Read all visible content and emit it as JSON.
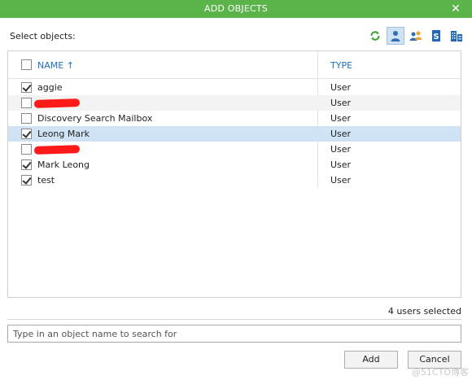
{
  "dialog": {
    "title": "ADD OBJECTS",
    "close_glyph": "✕"
  },
  "select_label": "Select objects:",
  "toolbar": {
    "icons": [
      "refresh-icon",
      "user-icon",
      "group-icon",
      "sharepoint-icon",
      "building-icon"
    ],
    "active": "user-icon"
  },
  "table": {
    "header": {
      "name": "NAME",
      "sort_arrow": "↑",
      "type": "TYPE"
    },
    "rows": [
      {
        "name": "aggie",
        "type": "User",
        "checked": true
      },
      {
        "name": "",
        "type": "User",
        "checked": false,
        "redacted": true
      },
      {
        "name": "Discovery Search Mailbox",
        "type": "User",
        "checked": false
      },
      {
        "name": "Leong Mark",
        "type": "User",
        "checked": true,
        "selected": true
      },
      {
        "name": "",
        "type": "User",
        "checked": false,
        "redacted": true
      },
      {
        "name": "Mark Leong",
        "type": "User",
        "checked": true
      },
      {
        "name": "test",
        "type": "User",
        "checked": true
      }
    ]
  },
  "selection_count": "4 users selected",
  "search": {
    "placeholder": "Type in an object name to search for",
    "value": ""
  },
  "buttons": {
    "add": "Add",
    "cancel": "Cancel"
  },
  "watermark": "@51CTO博客",
  "colors": {
    "title_bar": "#5bb44a",
    "accent": "#1e6fc2",
    "selected_row": "#cfe3f5",
    "redaction": "#ff1a1a"
  }
}
